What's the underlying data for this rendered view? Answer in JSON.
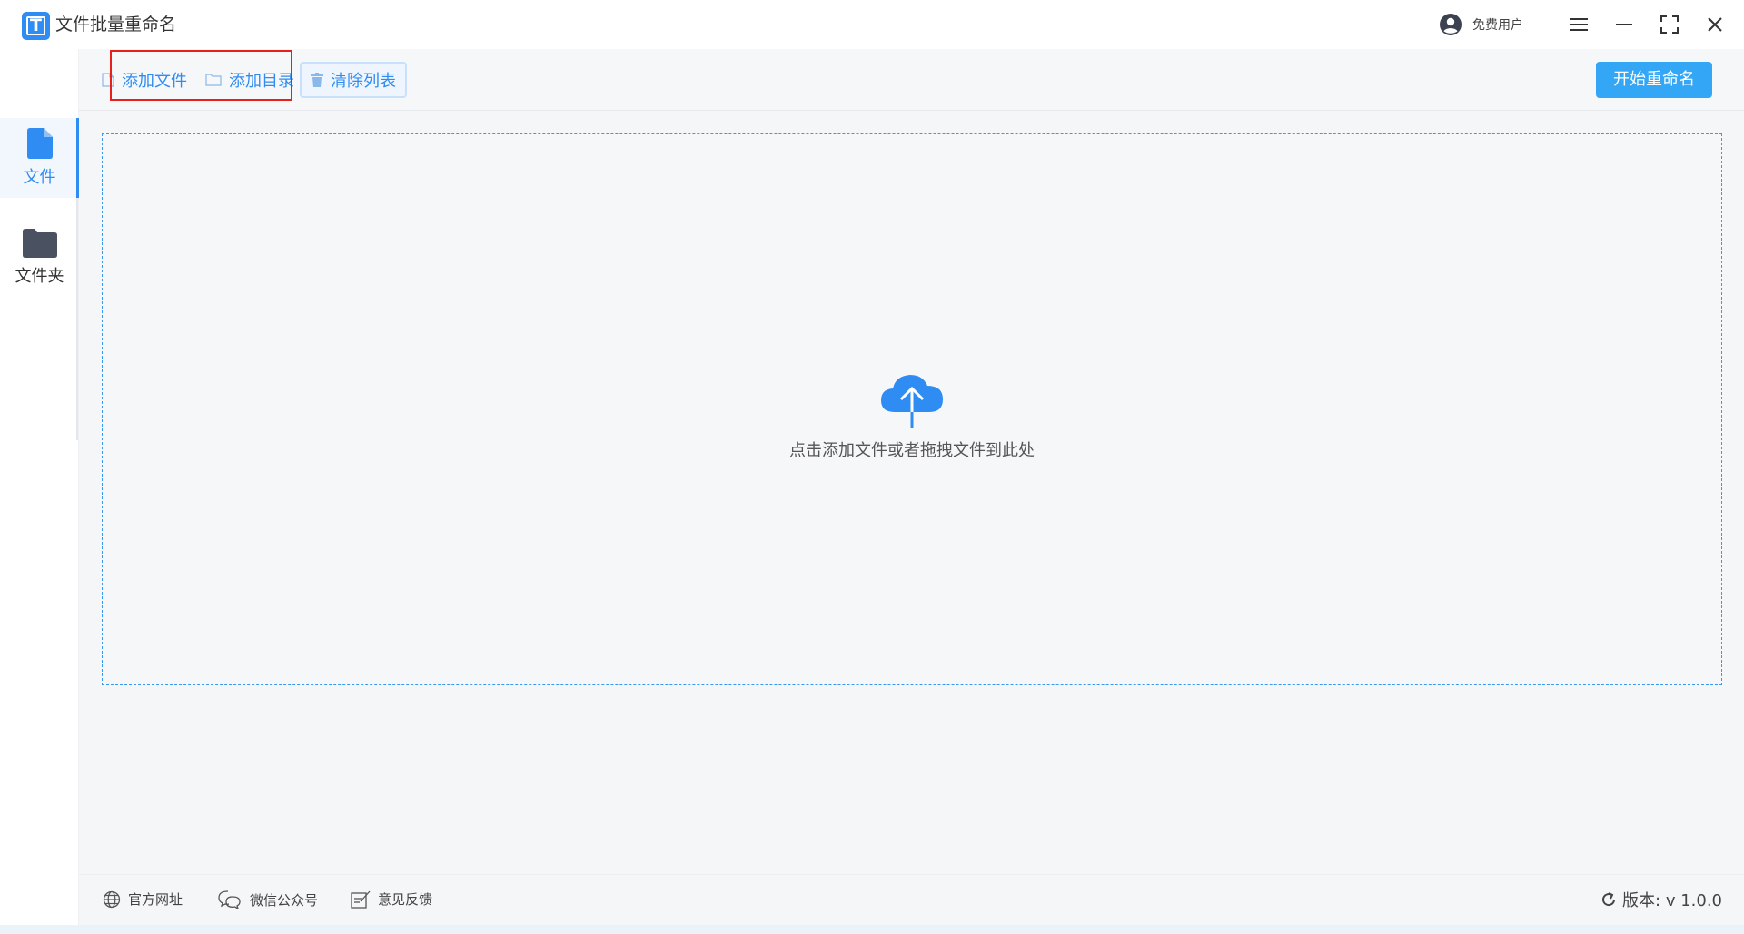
{
  "titlebar": {
    "app_title": "文件批量重命名",
    "logo_letter": "T",
    "user_label": "免费用户"
  },
  "sidebar": {
    "items": [
      {
        "label": "文件",
        "icon": "file-icon",
        "active": true
      },
      {
        "label": "文件夹",
        "icon": "folder-icon",
        "active": false
      }
    ]
  },
  "toolbar": {
    "add_file": "添加文件",
    "add_dir": "添加目录",
    "clear_list": "清除列表",
    "start_rename": "开始重命名"
  },
  "dropzone": {
    "hint": "点击添加文件或者拖拽文件到此处"
  },
  "footer": {
    "website": "官方网址",
    "wechat": "微信公众号",
    "feedback": "意见反馈",
    "version": "版本: v 1.0.0"
  },
  "colors": {
    "accent": "#2f8cf2",
    "start_button": "#33a6f5",
    "highlight": "#e8201c"
  }
}
